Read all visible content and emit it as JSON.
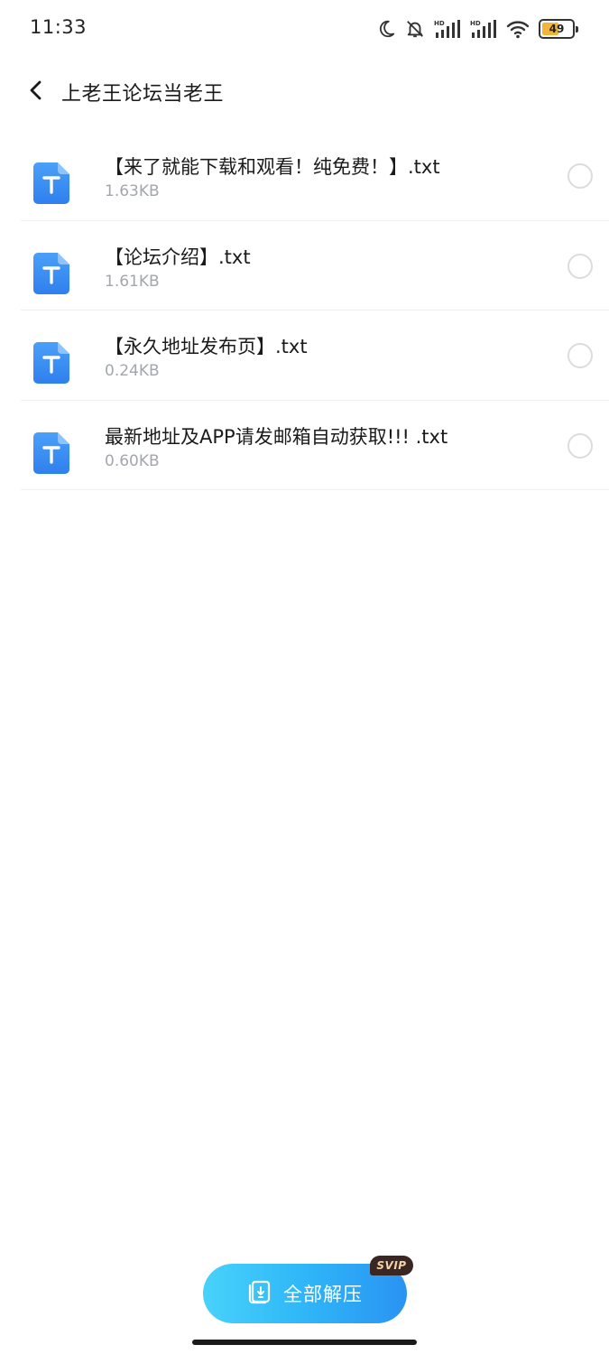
{
  "status_bar": {
    "time": "11:33",
    "battery_level": "49",
    "icons": [
      "moon-icon",
      "bell-muted-icon",
      "signal-hd-icon",
      "signal-hd-icon",
      "wifi-icon",
      "battery-icon"
    ]
  },
  "header": {
    "title": "上老王论坛当老王",
    "back_icon": "chevron-left-icon"
  },
  "files": [
    {
      "name": "【来了就能下载和观看！纯免费！】.txt",
      "size": "1.63KB",
      "icon": "txt-file-icon",
      "selected": false
    },
    {
      "name": "【论坛介绍】.txt",
      "size": "1.61KB",
      "icon": "txt-file-icon",
      "selected": false
    },
    {
      "name": "【永久地址发布页】.txt",
      "size": "0.24KB",
      "icon": "txt-file-icon",
      "selected": false
    },
    {
      "name": "最新地址及APP请发邮箱自动获取!!! .txt",
      "size": "0.60KB",
      "icon": "txt-file-icon",
      "selected": false
    }
  ],
  "actions": {
    "extract_all_label": "全部解压",
    "extract_icon": "extract-icon",
    "badge": "SVIP"
  },
  "colors": {
    "accent_gradient_start": "#48d2fa",
    "accent_gradient_end": "#2a93f2",
    "file_icon_blue": "#3d8ff5",
    "secondary_text": "#a3a6ad",
    "badge_bg": "#3a2622",
    "badge_text": "#f3d2a3"
  }
}
